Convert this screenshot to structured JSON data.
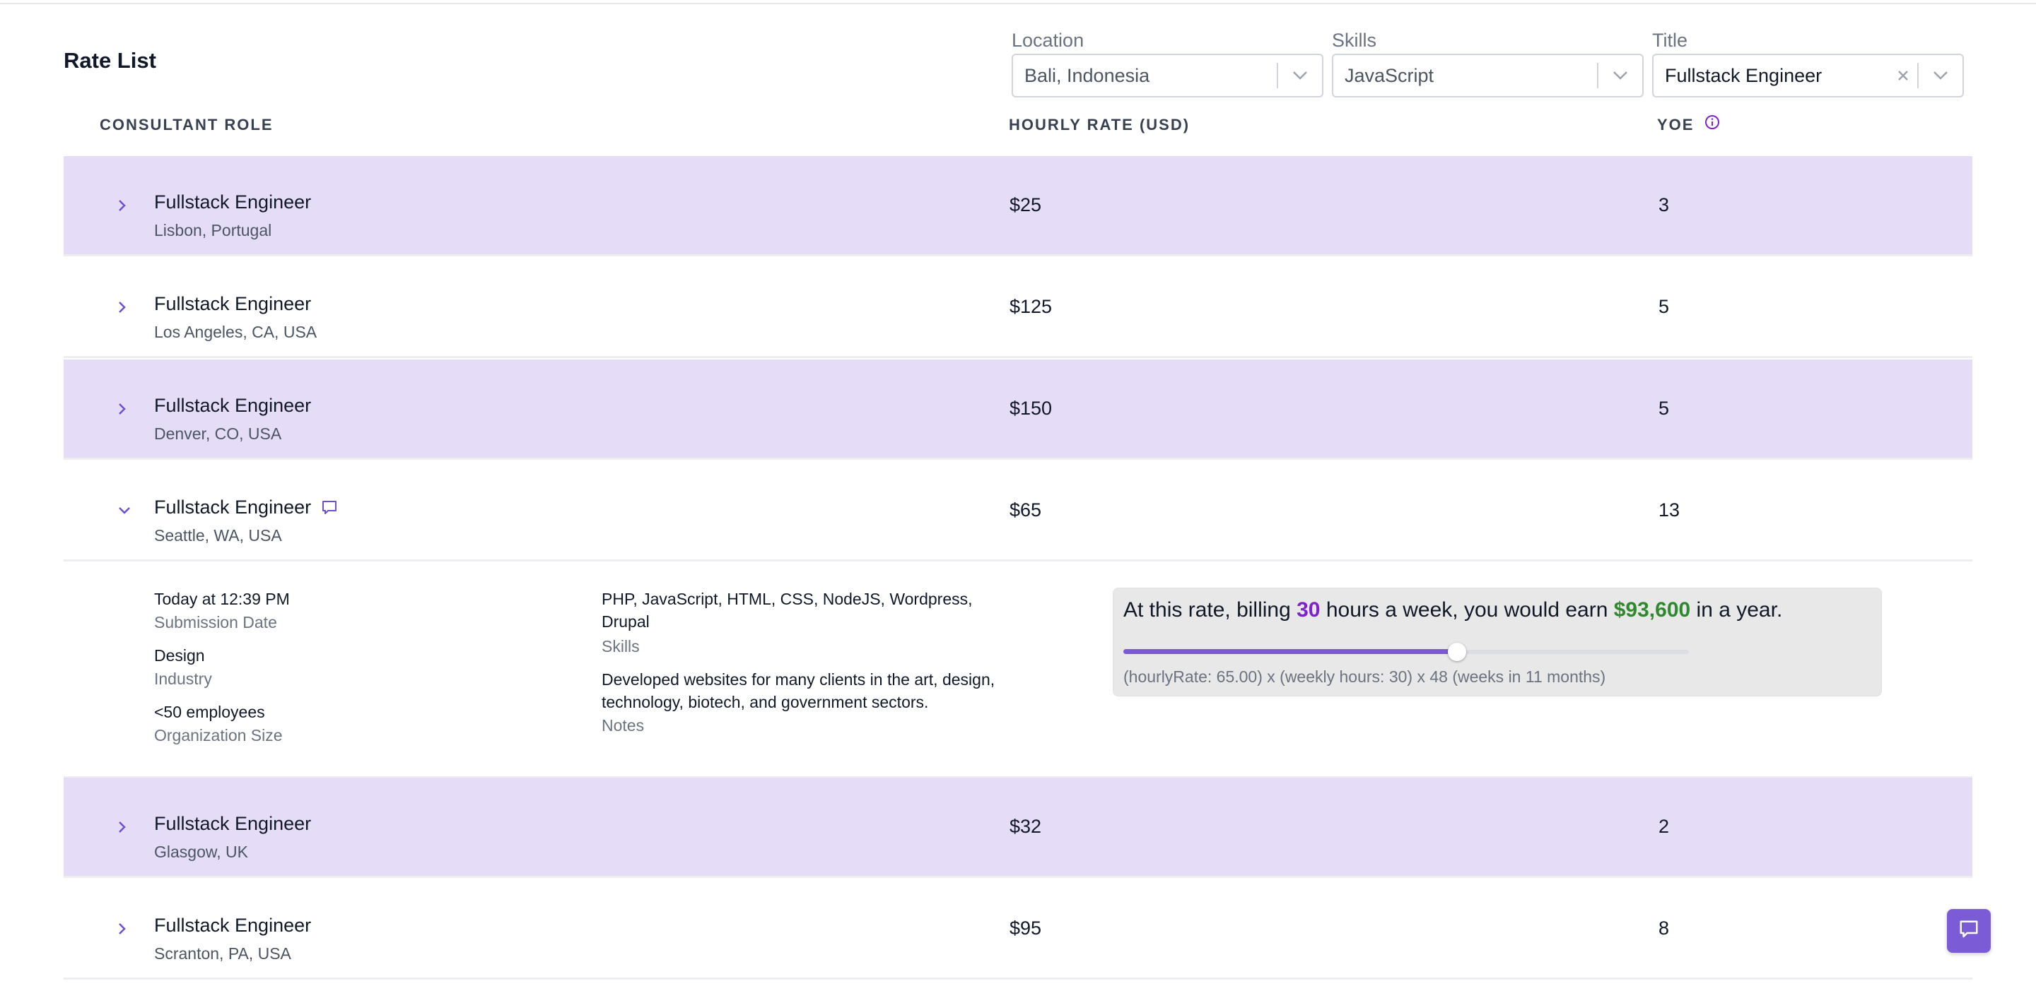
{
  "page": {
    "title": "Rate List"
  },
  "filters": {
    "location": {
      "label": "Location",
      "value": "Bali, Indonesia"
    },
    "skills": {
      "label": "Skills",
      "value": "JavaScript"
    },
    "title": {
      "label": "Title",
      "value": "Fullstack Engineer"
    }
  },
  "table": {
    "headers": {
      "role": "CONSULTANT ROLE",
      "rate": "HOURLY RATE (USD)",
      "yoe": "YOE"
    },
    "rows": [
      {
        "title": "Fullstack Engineer",
        "location": "Lisbon, Portugal",
        "rate": "$25",
        "yoe": "3"
      },
      {
        "title": "Fullstack Engineer",
        "location": "Los Angeles, CA, USA",
        "rate": "$125",
        "yoe": "5"
      },
      {
        "title": "Fullstack Engineer",
        "location": "Denver, CO, USA",
        "rate": "$150",
        "yoe": "5"
      },
      {
        "title": "Fullstack Engineer",
        "location": "Seattle, WA, USA",
        "rate": "$65",
        "yoe": "13"
      },
      {
        "title": "Fullstack Engineer",
        "location": "Glasgow, UK",
        "rate": "$32",
        "yoe": "2"
      },
      {
        "title": "Fullstack Engineer",
        "location": "Scranton, PA, USA",
        "rate": "$95",
        "yoe": "8"
      }
    ]
  },
  "details": {
    "submission_date": {
      "value": "Today at 12:39 PM",
      "label": "Submission Date"
    },
    "industry": {
      "value": "Design",
      "label": "Industry"
    },
    "org_size": {
      "value": "<50 employees",
      "label": "Organization Size"
    },
    "skills": {
      "value": "PHP, JavaScript, HTML, CSS, NodeJS, Wordpress, Drupal",
      "label": "Skills"
    },
    "notes": {
      "value": "Developed websites for many clients in the art, design, technology, biotech, and government sectors.",
      "label": "Notes"
    },
    "calculator": {
      "prefix": "At this rate, billing ",
      "hours": "30",
      "middle": " hours a week, you would earn ",
      "earnings": "$93,600",
      "suffix": " in a year.",
      "slider_fraction": 0.59,
      "formula": "(hourlyRate: 65.00) x (weekly hours: 30) x 48 (weeks in 11 months)"
    }
  },
  "colors": {
    "accent": "#7c5cd6",
    "row_highlight": "#e5dcf8",
    "earnings": "#2f8a2f",
    "hours": "#7e22ce"
  }
}
